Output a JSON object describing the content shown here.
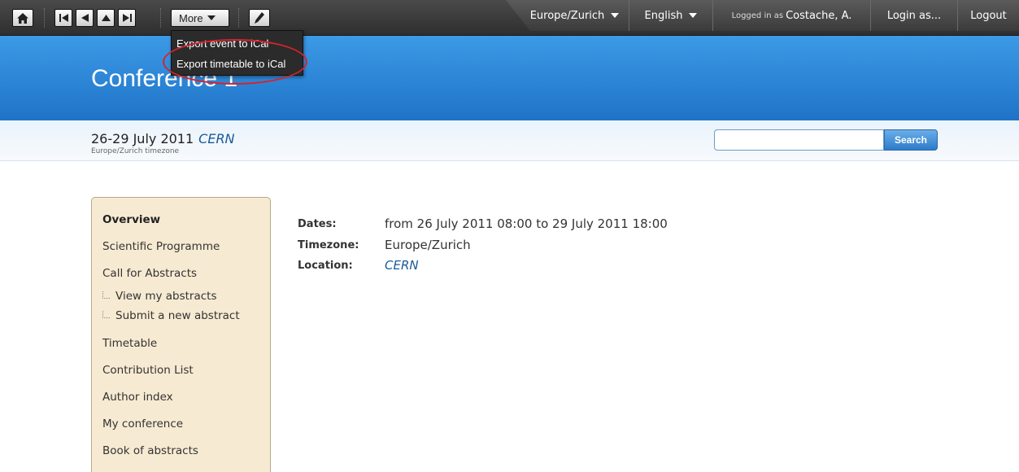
{
  "toolbar": {
    "more_label": "More",
    "icons": [
      "home-icon",
      "first-icon",
      "previous-icon",
      "up-icon",
      "last-icon",
      "edit-icon"
    ],
    "timezone": "Europe/Zurich",
    "language": "English",
    "logged_in_prefix": "Logged in as",
    "user": "Costache, A.",
    "login_as": "Login as...",
    "logout": "Logout"
  },
  "more_menu": {
    "items": [
      "Export event to iCal",
      "Export timetable to iCal"
    ],
    "highlight_color": "#d6232c"
  },
  "banner": {
    "title": "Conference 1",
    "color": "#2a86d8"
  },
  "subheader": {
    "dates": "26-29 July 2011",
    "location": "CERN",
    "timezone_note": "Europe/Zurich timezone",
    "search_value": "",
    "search_button": "Search"
  },
  "sidebar": {
    "items": [
      {
        "label": "Overview",
        "active": true
      },
      {
        "label": "Scientific Programme"
      },
      {
        "label": "Call for Abstracts"
      },
      {
        "label": "View my abstracts",
        "sub": true
      },
      {
        "label": "Submit a new abstract",
        "sub": true
      },
      {
        "label": "Timetable"
      },
      {
        "label": "Contribution List"
      },
      {
        "label": "Author index"
      },
      {
        "label": "My conference"
      },
      {
        "label": "Book of abstracts"
      }
    ]
  },
  "details": {
    "dates_label": "Dates:",
    "dates_value": "from 26 July 2011 08:00 to 29 July 2011 18:00",
    "timezone_label": "Timezone:",
    "timezone_value": "Europe/Zurich",
    "location_label": "Location:",
    "location_value": "CERN"
  }
}
